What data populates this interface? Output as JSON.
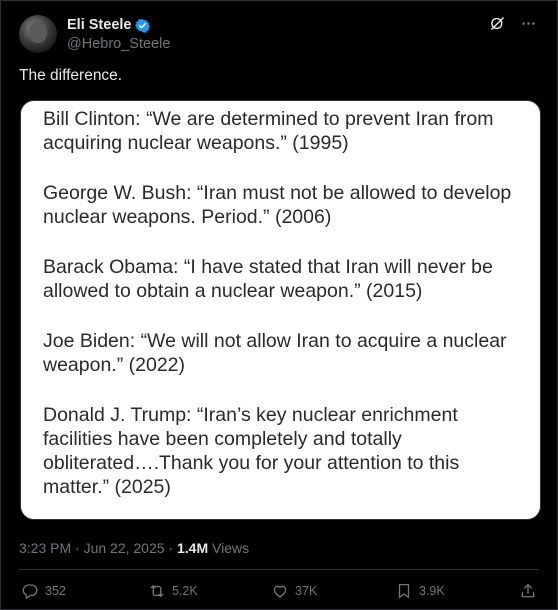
{
  "author": {
    "display_name": "Eli Steele",
    "handle": "@Hebro_Steele",
    "verified": true
  },
  "tweet": {
    "text": "The difference."
  },
  "quote_image": {
    "quotes": [
      "Bill Clinton: “We are determined to prevent Iran from acquiring nuclear weapons.” (1995)",
      "George W. Bush: “Iran must not be allowed to develop nuclear weapons. Period.” (2006)",
      "Barack Obama: “I have stated that Iran will never be allowed to obtain a nuclear weapon.” (2015)",
      "Joe Biden: “We will not allow Iran to acquire a nuclear weapon.” (2022)",
      "Donald J. Trump: “Iran’s key nuclear enrichment facilities have been completely and totally obliterated….Thank you for your attention to this matter.” (2025)"
    ]
  },
  "meta": {
    "time_date": "3:23 PM · Jun 22, 2025 · ",
    "views_count": "1.4M",
    "views_label": " Views"
  },
  "actions": {
    "replies": "352",
    "reposts": "5.2K",
    "likes": "37K",
    "bookmarks": "3.9K"
  },
  "colors": {
    "background": "#000000",
    "text": "#e7e9ea",
    "secondary": "#71767b",
    "verified": "#1d9bf0"
  },
  "icons": [
    "verified-badge-icon",
    "grok-icon",
    "more-icon",
    "reply-icon",
    "retweet-icon",
    "like-icon",
    "bookmark-icon",
    "share-icon"
  ]
}
